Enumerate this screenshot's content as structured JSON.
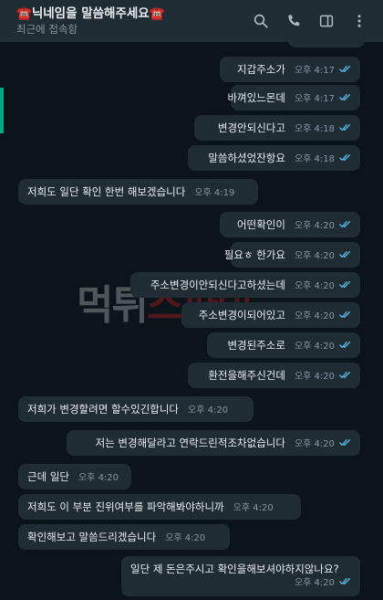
{
  "header": {
    "phone_glyph": "☎️",
    "title_text": "닉네임을 말씀해주세요",
    "subtitle": "최근에 접속함",
    "icons": [
      "search-icon",
      "call-icon",
      "sidebar-icon",
      "menu-icon"
    ]
  },
  "colors": {
    "background": "#0b141a",
    "header": "#202c33",
    "bubble_out": "#1f2c34",
    "bubble_in": "#202c33",
    "tick": "#53bdeb",
    "accent": "#00a884"
  },
  "watermark": {
    "text_a": "먹튀",
    "text_b": "스파이"
  },
  "messages": [
    {
      "dir": "out",
      "text": "",
      "time": "오후 4:17"
    },
    {
      "dir": "out",
      "text": "지갑주소가",
      "time": "오후 4:17"
    },
    {
      "dir": "out",
      "text": "바껴있느몬데",
      "time": "오후 4:17"
    },
    {
      "dir": "out",
      "text": "변경안되신다고",
      "time": "오후 4:18"
    },
    {
      "dir": "out",
      "text": "말씀하셨었잔항요",
      "time": "오후 4:18"
    },
    {
      "dir": "in",
      "text": "저희도 일단 확인 한번 해보겠습니다",
      "time": "오후 4:19"
    },
    {
      "dir": "out",
      "text": "어떤확인이",
      "time": "오후 4:20"
    },
    {
      "dir": "out",
      "text": "필요ㅎ 한가요",
      "time": "오후 4:20"
    },
    {
      "dir": "out",
      "text": "주소변경이안되신다고하셨는데",
      "time": "오후 4:20"
    },
    {
      "dir": "out",
      "text": "주소변경이되어있고",
      "time": "오후 4:20"
    },
    {
      "dir": "out",
      "text": "변경된주소로",
      "time": "오후 4:20"
    },
    {
      "dir": "out",
      "text": "환전을해주신건데",
      "time": "오후 4:20"
    },
    {
      "dir": "in",
      "text": "저희가 변경할려면 할수있긴합니다",
      "time": "오후 4:20"
    },
    {
      "dir": "out",
      "text": "저는 변경해달라고 연락드린적조차없습니다",
      "time": "오후 4:20"
    },
    {
      "dir": "in",
      "text": "근데 일단",
      "time": "오후 4:20"
    },
    {
      "dir": "in",
      "text": "저희도 이 부분 진위여부를 파악해봐야하니까",
      "time": "오후 4:20"
    },
    {
      "dir": "in",
      "text": "확인해보고 말씀드리겠습니다",
      "time": "오후 4:20"
    },
    {
      "dir": "out",
      "text": "일단 제 돈은주시고 확인을해보셔야하지않나요?",
      "time": "오후 4:20"
    }
  ]
}
